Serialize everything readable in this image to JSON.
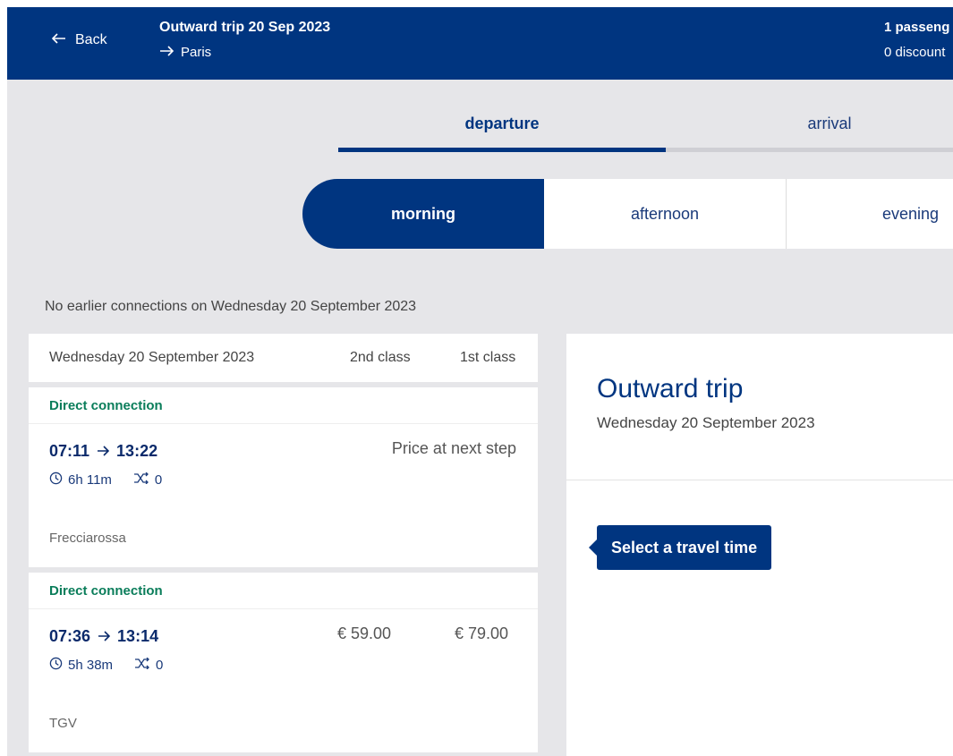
{
  "header": {
    "back_label": "Back",
    "trip_title": "Outward trip 20 Sep 2023",
    "destination": "Paris",
    "passengers": "1 passeng",
    "discounts": "0 discount"
  },
  "tabs": {
    "departure": "departure",
    "arrival": "arrival"
  },
  "time_of_day": {
    "morning": "morning",
    "afternoon": "afternoon",
    "evening": "evening"
  },
  "no_earlier": "No earlier connections on Wednesday 20 September 2023",
  "list": {
    "date": "Wednesday 20 September 2023",
    "class2": "2nd class",
    "class1": "1st class",
    "connections": [
      {
        "type": "Direct connection",
        "depart": "07:11",
        "arrive": "13:22",
        "duration": "6h 11m",
        "changes": "0",
        "price_note": "Price at next step",
        "train": "Frecciarossa"
      },
      {
        "type": "Direct connection",
        "depart": "07:36",
        "arrive": "13:14",
        "duration": "5h 38m",
        "changes": "0",
        "price2": "€ 59.00",
        "price1": "€ 79.00",
        "train": "TGV"
      }
    ]
  },
  "panel": {
    "title": "Outward trip",
    "date": "Wednesday 20 September 2023",
    "tooltip": "Select a travel time"
  },
  "colors": {
    "brand": "#003580",
    "direct": "#0a7d5a",
    "background": "#e6e6e9"
  }
}
